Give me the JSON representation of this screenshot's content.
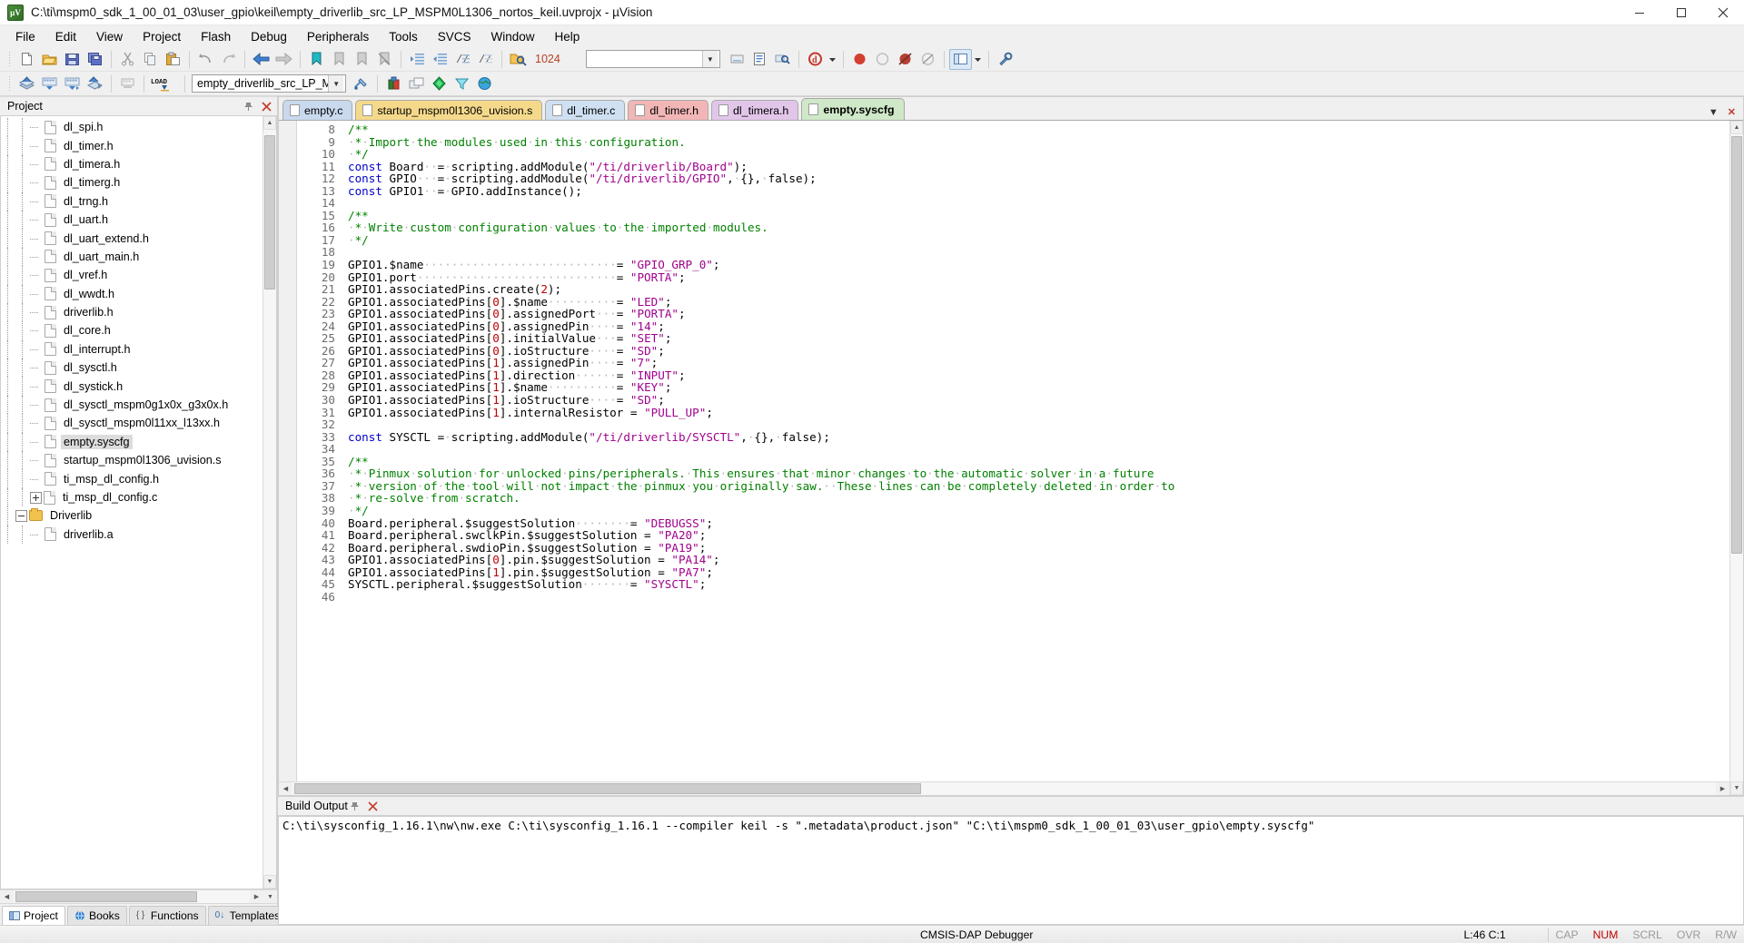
{
  "window": {
    "title": "C:\\ti\\mspm0_sdk_1_00_01_03\\user_gpio\\keil\\empty_driverlib_src_LP_MSPM0L1306_nortos_keil.uvprojx - µVision",
    "app_icon": "uvision-icon",
    "minimize": "minimize-icon",
    "maximize": "maximize-icon",
    "close": "close-icon"
  },
  "menu": {
    "items": [
      "File",
      "Edit",
      "View",
      "Project",
      "Flash",
      "Debug",
      "Peripherals",
      "Tools",
      "SVCS",
      "Window",
      "Help"
    ]
  },
  "toolbar1": {
    "icons": [
      "new-file-icon",
      "open-file-icon",
      "save-icon",
      "save-all-icon",
      "cut-icon",
      "copy-icon",
      "paste-icon",
      "undo-icon",
      "redo-icon",
      "navigate-back-icon",
      "navigate-forward-icon",
      "bookmark-toggle-icon",
      "bookmark-prev-icon",
      "bookmark-next-icon",
      "bookmark-clear-icon",
      "indent-icon",
      "outdent-icon",
      "comment-icon",
      "uncomment-icon",
      "find-in-files-icon"
    ],
    "find_value": "1024",
    "right_icons": [
      "insert-file-icon",
      "configuration-wizard-icon",
      "find-icon",
      "debug-icon",
      "debug-dropdown-icon",
      "stop-icon",
      "breakpoint-icon",
      "disable-breakpoint-icon",
      "kill-breakpoints-icon",
      "window-layout-icon",
      "layout-dropdown-icon",
      "settings-icon"
    ]
  },
  "toolbar2": {
    "icons": [
      "build-icon",
      "build-target-icon",
      "rebuild-icon",
      "batch-build-icon",
      "stop-build-icon",
      "load-icon"
    ],
    "target_value": "empty_driverlib_src_LP_M",
    "right_icons": [
      "target-options-icon",
      "manage-project-items-icon",
      "pack-installer-icon",
      "manage-run-time-env-icon",
      "select-software-packs-icon",
      "pack-installer2-icon"
    ]
  },
  "project_panel": {
    "title": "Project",
    "pin_icon": "pin-icon",
    "close_icon": "close-icon",
    "tree": [
      {
        "label": "dl_spi.h",
        "type": "file",
        "depth": 3,
        "selected": false
      },
      {
        "label": "dl_timer.h",
        "type": "file",
        "depth": 3,
        "selected": false
      },
      {
        "label": "dl_timera.h",
        "type": "file",
        "depth": 3,
        "selected": false
      },
      {
        "label": "dl_timerg.h",
        "type": "file",
        "depth": 3,
        "selected": false
      },
      {
        "label": "dl_trng.h",
        "type": "file",
        "depth": 3,
        "selected": false
      },
      {
        "label": "dl_uart.h",
        "type": "file",
        "depth": 3,
        "selected": false
      },
      {
        "label": "dl_uart_extend.h",
        "type": "file",
        "depth": 3,
        "selected": false
      },
      {
        "label": "dl_uart_main.h",
        "type": "file",
        "depth": 3,
        "selected": false
      },
      {
        "label": "dl_vref.h",
        "type": "file",
        "depth": 3,
        "selected": false
      },
      {
        "label": "dl_wwdt.h",
        "type": "file",
        "depth": 3,
        "selected": false
      },
      {
        "label": "driverlib.h",
        "type": "file",
        "depth": 3,
        "selected": false
      },
      {
        "label": "dl_core.h",
        "type": "file",
        "depth": 3,
        "selected": false
      },
      {
        "label": "dl_interrupt.h",
        "type": "file",
        "depth": 3,
        "selected": false
      },
      {
        "label": "dl_sysctl.h",
        "type": "file",
        "depth": 3,
        "selected": false
      },
      {
        "label": "dl_systick.h",
        "type": "file",
        "depth": 3,
        "selected": false
      },
      {
        "label": "dl_sysctl_mspm0g1x0x_g3x0x.h",
        "type": "file",
        "depth": 3,
        "selected": false
      },
      {
        "label": "dl_sysctl_mspm0l11xx_l13xx.h",
        "type": "file",
        "depth": 3,
        "selected": false
      },
      {
        "label": "empty.syscfg",
        "type": "file",
        "depth": 3,
        "selected": true
      },
      {
        "label": "startup_mspm0l1306_uvision.s",
        "type": "file",
        "depth": 3,
        "selected": false
      },
      {
        "label": "ti_msp_dl_config.h",
        "type": "file",
        "depth": 3,
        "selected": false
      },
      {
        "label": "ti_msp_dl_config.c",
        "type": "file",
        "depth": 3,
        "selected": false,
        "expander": "plus"
      },
      {
        "label": "Driverlib",
        "type": "folder",
        "depth": 2,
        "selected": false,
        "expander": "minus"
      },
      {
        "label": "driverlib.a",
        "type": "file",
        "depth": 3,
        "selected": false
      }
    ],
    "tabs": [
      {
        "label": "Project",
        "icon": "project-icon",
        "active": true
      },
      {
        "label": "Books",
        "icon": "books-icon",
        "active": false
      },
      {
        "label": "Functions",
        "icon": "functions-icon",
        "active": false
      },
      {
        "label": "Templates",
        "icon": "templates-icon",
        "active": false
      }
    ]
  },
  "editor": {
    "tabs": [
      {
        "label": "empty.c",
        "color": "#c9d9ee",
        "active": false
      },
      {
        "label": "startup_mspm0l1306_uvision.s",
        "color": "#f5d98b",
        "active": false
      },
      {
        "label": "dl_timer.c",
        "color": "#cfe0f2",
        "active": false
      },
      {
        "label": "dl_timer.h",
        "color": "#f2b6b6",
        "active": false
      },
      {
        "label": "dl_timera.h",
        "color": "#e2c6ea",
        "active": false
      },
      {
        "label": "empty.syscfg",
        "color": "#cfe8c8",
        "active": true
      }
    ],
    "tab_controls": [
      "chevron-down-icon",
      "close-icon"
    ],
    "first_line": 8,
    "lines": [
      "/**",
      " * Import the modules used in this configuration.",
      " */",
      "const Board  = scripting.addModule(\"/ti/driverlib/Board\");",
      "const GPIO   = scripting.addModule(\"/ti/driverlib/GPIO\", {}, false);",
      "const GPIO1  = GPIO.addInstance();",
      "",
      "/**",
      " * Write custom configuration values to the imported modules.",
      " */",
      "",
      "GPIO1.$name                            = \"GPIO_GRP_0\";",
      "GPIO1.port                             = \"PORTA\";",
      "GPIO1.associatedPins.create(2);",
      "GPIO1.associatedPins[0].$name          = \"LED\";",
      "GPIO1.associatedPins[0].assignedPort   = \"PORTA\";",
      "GPIO1.associatedPins[0].assignedPin    = \"14\";",
      "GPIO1.associatedPins[0].initialValue   = \"SET\";",
      "GPIO1.associatedPins[0].ioStructure    = \"SD\";",
      "GPIO1.associatedPins[1].assignedPin    = \"7\";",
      "GPIO1.associatedPins[1].direction      = \"INPUT\";",
      "GPIO1.associatedPins[1].$name          = \"KEY\";",
      "GPIO1.associatedPins[1].ioStructure    = \"SD\";",
      "GPIO1.associatedPins[1].internalResistor = \"PULL_UP\";",
      "",
      "const SYSCTL = scripting.addModule(\"/ti/driverlib/SYSCTL\", {}, false);",
      "",
      "/**",
      " * Pinmux solution for unlocked pins/peripherals. This ensures that minor changes to the automatic solver in a future",
      " * version of the tool will not impact the pinmux you originally saw.  These lines can be completely deleted in order to",
      " * re-solve from scratch.",
      " */",
      "Board.peripheral.$suggestSolution        = \"DEBUGSS\";",
      "Board.peripheral.swclkPin.$suggestSolution = \"PA20\";",
      "Board.peripheral.swdioPin.$suggestSolution = \"PA19\";",
      "GPIO1.associatedPins[0].pin.$suggestSolution = \"PA14\";",
      "GPIO1.associatedPins[1].pin.$suggestSolution = \"PA7\";",
      "SYSCTL.peripheral.$suggestSolution       = \"SYSCTL\";",
      ""
    ]
  },
  "build_output": {
    "title": "Build Output",
    "pin_icon": "pin-icon",
    "close_icon": "close-icon",
    "lines": [
      "C:\\ti\\sysconfig_1.16.1\\nw\\nw.exe C:\\ti\\sysconfig_1.16.1 --compiler keil -s \".metadata\\product.json\" \"C:\\ti\\mspm0_sdk_1_00_01_03\\user_gpio\\empty.syscfg\""
    ]
  },
  "statusbar": {
    "debugger": "CMSIS-DAP Debugger",
    "position": "L:46 C:1",
    "cap": "CAP",
    "num": "NUM",
    "scrl": "SCRL",
    "ovr": "OVR",
    "rw": "R/W"
  },
  "colors": {
    "accent": "#0078d7",
    "string": "#a0008c",
    "keyword": "#0000c8",
    "number": "#c00000",
    "selection": "#dcdcdc"
  }
}
